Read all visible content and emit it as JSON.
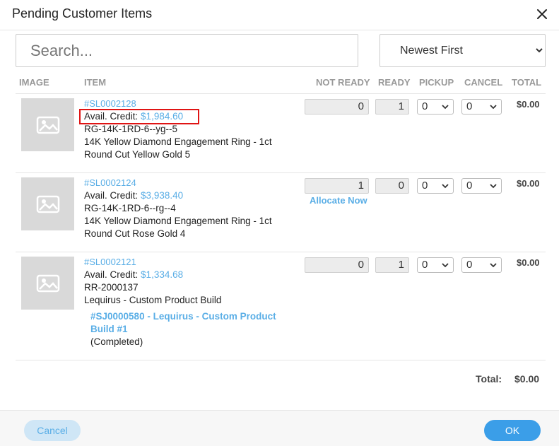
{
  "dialog": {
    "title": "Pending Customer Items"
  },
  "search": {
    "placeholder": "Search..."
  },
  "sort": {
    "selected": "Newest First"
  },
  "columns": {
    "image": "IMAGE",
    "item": "ITEM",
    "not_ready": "NOT READY",
    "ready": "READY",
    "pickup": "PICKUP",
    "cancel": "CANCEL",
    "total": "TOTAL"
  },
  "credit_label": "Avail. Credit:",
  "rows": [
    {
      "id": "#SL0002128",
      "credit": "$1,984.60",
      "sku": "RG-14K-1RD-6--yg--5",
      "desc1": "14K Yellow Diamond Engagement Ring - 1ct",
      "desc2": "Round Cut Yellow Gold 5",
      "not_ready": "0",
      "ready": "1",
      "pickup": "0",
      "cancel": "0",
      "total": "$0.00"
    },
    {
      "id": "#SL0002124",
      "credit": "$3,938.40",
      "sku": "RG-14K-1RD-6--rg--4",
      "desc1": "14K Yellow Diamond Engagement Ring - 1ct",
      "desc2": "Round Cut Rose Gold 4",
      "not_ready": "1",
      "ready": "0",
      "pickup": "0",
      "cancel": "0",
      "total": "$0.00",
      "allocate": "Allocate Now"
    },
    {
      "id": "#SL0002121",
      "credit": "$1,334.68",
      "sku": "RR-2000137",
      "desc1": "Lequirus - Custom Product Build",
      "job_line1": "#SJ0000580 - Lequirus - Custom Product",
      "job_line2": "Build #1",
      "job_status": "(Completed)",
      "not_ready": "0",
      "ready": "1",
      "pickup": "0",
      "cancel": "0",
      "total": "$0.00"
    }
  ],
  "summary": {
    "label": "Total:",
    "value": "$0.00"
  },
  "footer": {
    "cancel": "Cancel",
    "ok": "OK"
  },
  "colors": {
    "accent": "#5aaee6",
    "primary_button": "#3b9ee8",
    "highlight": "#e01414"
  }
}
